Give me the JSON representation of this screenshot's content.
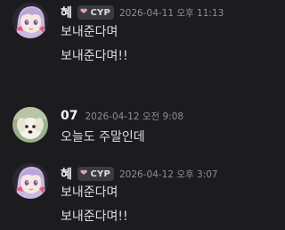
{
  "messages": [
    {
      "username": "혜",
      "tag": "CYP",
      "tag_icon": "heart-icon",
      "tag_icon_color": "#f0a0b0",
      "timestamp": "2026-04-11 오후 11:13",
      "lines": [
        "보내준다며",
        "보내준다며!!"
      ],
      "avatar": "anime-girl-avatar"
    },
    {
      "username": "07",
      "timestamp": "2026-04-12 오전 9:08",
      "lines": [
        "오늘도 주말인데"
      ],
      "avatar": "white-puppy-avatar"
    },
    {
      "username": "혜",
      "tag": "CYP",
      "tag_icon": "heart-icon",
      "tag_icon_color": "#f0a0b0",
      "timestamp": "2026-04-12 오후 3:07",
      "lines": [
        "보내준다며",
        "보내준다며!!"
      ],
      "avatar": "anime-girl-avatar"
    }
  ],
  "colors": {
    "background": "#1c1c1f",
    "username": "#f2f3f5",
    "text": "#dbdee1",
    "timestamp": "#8c8f96",
    "tag_bg": "#3a3b40"
  }
}
